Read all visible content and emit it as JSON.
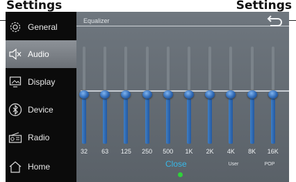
{
  "page": {
    "title_left": "Settings",
    "title_right": "Settings"
  },
  "sidebar": {
    "items": [
      {
        "label": "General",
        "icon": "gear-icon",
        "active": false
      },
      {
        "label": "Audio",
        "icon": "speaker-icon",
        "active": true
      },
      {
        "label": "Display",
        "icon": "display-icon",
        "active": false
      },
      {
        "label": "Device",
        "icon": "bluetooth-icon",
        "active": false
      },
      {
        "label": "Radio",
        "icon": "radio-icon",
        "active": false
      },
      {
        "label": "Home",
        "icon": "home-icon",
        "active": false
      }
    ]
  },
  "equalizer": {
    "title": "Equalizer",
    "bands": [
      {
        "label": "32",
        "level": 0.5
      },
      {
        "label": "63",
        "level": 0.5
      },
      {
        "label": "125",
        "level": 0.5
      },
      {
        "label": "250",
        "level": 0.5
      },
      {
        "label": "500",
        "level": 0.5
      },
      {
        "label": "1K",
        "level": 0.5
      },
      {
        "label": "2K",
        "level": 0.5
      },
      {
        "label": "4K",
        "level": 0.5
      },
      {
        "label": "8K",
        "level": 0.5
      },
      {
        "label": "16K",
        "level": 0.5
      }
    ],
    "presets": [
      "User",
      "POP"
    ],
    "close_label": "Close"
  },
  "colors": {
    "accent": "#37b8e8",
    "indicator": "#2fd23a",
    "slider_fill": "#2f69b4",
    "sidebar_bg": "#0b0b0b"
  }
}
